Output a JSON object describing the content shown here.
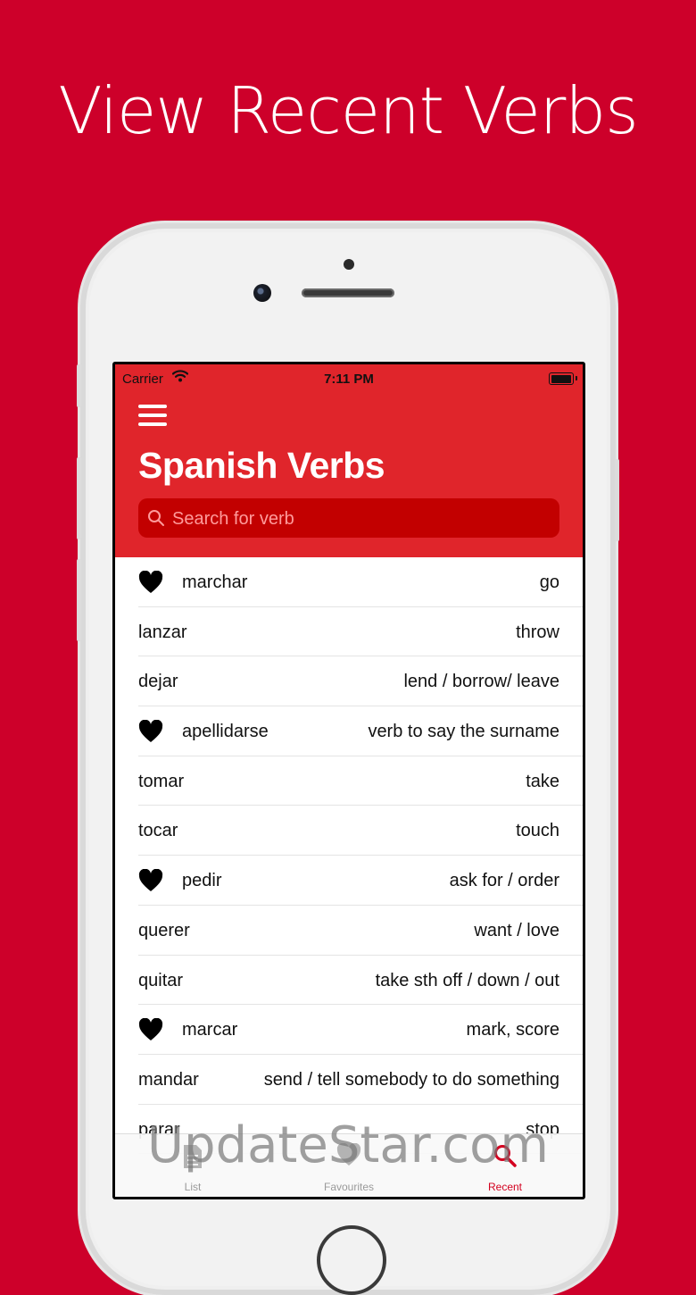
{
  "headline": "View Recent Verbs",
  "status_bar": {
    "carrier": "Carrier",
    "time": "7:11 PM"
  },
  "nav": {
    "title": "Spanish Verbs",
    "search_placeholder": "Search for verb"
  },
  "verbs": [
    {
      "verb": "marchar",
      "meaning": "go",
      "favourite": true
    },
    {
      "verb": "lanzar",
      "meaning": "throw",
      "favourite": false
    },
    {
      "verb": "dejar",
      "meaning": "lend / borrow/ leave",
      "favourite": false
    },
    {
      "verb": "apellidarse",
      "meaning": "verb to say the surname",
      "favourite": true
    },
    {
      "verb": "tomar",
      "meaning": "take",
      "favourite": false
    },
    {
      "verb": "tocar",
      "meaning": "touch",
      "favourite": false
    },
    {
      "verb": "pedir",
      "meaning": "ask for / order",
      "favourite": true
    },
    {
      "verb": "querer",
      "meaning": "want / love",
      "favourite": false
    },
    {
      "verb": "quitar",
      "meaning": "take sth off / down / out",
      "favourite": false
    },
    {
      "verb": "marcar",
      "meaning": "mark, score",
      "favourite": true
    },
    {
      "verb": "mandar",
      "meaning": "send / tell somebody to do something",
      "favourite": false
    },
    {
      "verb": "parar",
      "meaning": "stop",
      "favourite": false
    }
  ],
  "tabs": [
    {
      "label": "List",
      "icon": "document-icon",
      "active": false
    },
    {
      "label": "Favourites",
      "icon": "heart-icon",
      "active": false
    },
    {
      "label": "Recent",
      "icon": "search-recent-icon",
      "active": true
    }
  ],
  "watermark": "UpdateStar.com",
  "colors": {
    "background": "#cd002a",
    "nav": "#e0252b",
    "search": "#c20000",
    "active_tab": "#d3001f"
  }
}
